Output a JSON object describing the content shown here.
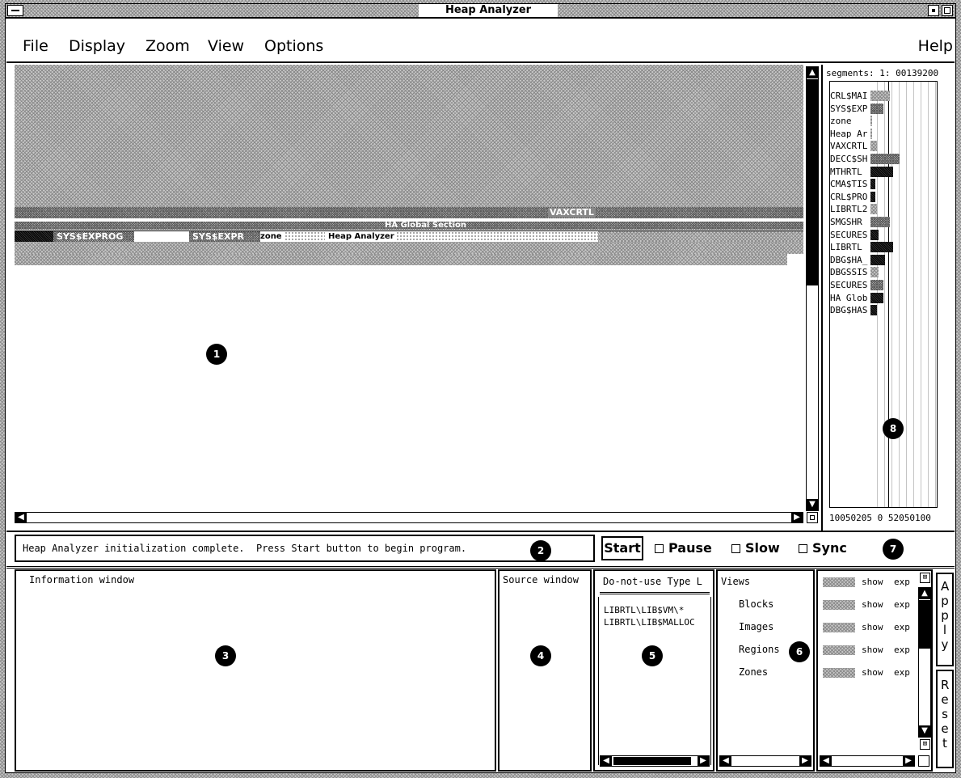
{
  "window": {
    "title": "Heap Analyzer"
  },
  "menu": {
    "file": "File",
    "display": "Display",
    "zoom": "Zoom",
    "view": "View",
    "options": "Options",
    "help": "Help"
  },
  "memory_map": {
    "band_labels": {
      "vaxcrtl": "VAXCRTL",
      "ha_global": "HA Global Section",
      "sys_exprog": "SYS$EXPROG",
      "sys_expr": "SYS$EXPR",
      "zone": "zone",
      "heap_analyzer": "Heap Analyzer"
    }
  },
  "histogram": {
    "header": "segments: 1: 00139200",
    "axis_labels": "10050205 0 52050100",
    "segments": [
      {
        "name": "CRL$MAI",
        "value": 12,
        "shade": "light"
      },
      {
        "name": "SYS$EXP",
        "value": 8,
        "shade": "medium"
      },
      {
        "name": "zone",
        "value": 1,
        "shade": "light"
      },
      {
        "name": "Heap Ar",
        "value": 1,
        "shade": "light"
      },
      {
        "name": "VAXCRTL",
        "value": 4,
        "shade": "light"
      },
      {
        "name": "DECC$SH",
        "value": 18,
        "shade": "medium"
      },
      {
        "name": "MTHRTL",
        "value": 14,
        "shade": "dark"
      },
      {
        "name": "CMA$TIS",
        "value": 3,
        "shade": "dark"
      },
      {
        "name": "CRL$PRO",
        "value": 3,
        "shade": "dark"
      },
      {
        "name": "LIBRTL2",
        "value": 4,
        "shade": "light"
      },
      {
        "name": "SMGSHR",
        "value": 12,
        "shade": "medium"
      },
      {
        "name": "SECURES",
        "value": 5,
        "shade": "dark"
      },
      {
        "name": "LIBRTL",
        "value": 14,
        "shade": "dark"
      },
      {
        "name": "DBG$HA_",
        "value": 9,
        "shade": "dark"
      },
      {
        "name": "DBGSSIS",
        "value": 5,
        "shade": "light"
      },
      {
        "name": "SECURES",
        "value": 8,
        "shade": "medium"
      },
      {
        "name": "HA Glob",
        "value": 8,
        "shade": "dark"
      },
      {
        "name": "DBG$HAS",
        "value": 4,
        "shade": "dark"
      }
    ]
  },
  "message": {
    "text": "Heap Analyzer initialization complete.  Press Start button to begin program."
  },
  "controls": {
    "start": "Start",
    "pause": "Pause",
    "slow": "Slow",
    "sync": "Sync"
  },
  "info": {
    "title": "Information window"
  },
  "source": {
    "title": "Source window"
  },
  "dnu": {
    "title": "Do-not-use Type L",
    "items": [
      "LIBRTL\\LIB$VM\\*",
      "LIBRTL\\LIB$MALLOC"
    ]
  },
  "views": {
    "title": "Views",
    "items": [
      "Blocks",
      "Images",
      "Regions",
      "Zones"
    ]
  },
  "types": {
    "rows": [
      {
        "show": "show",
        "exp": "exp"
      },
      {
        "show": "show",
        "exp": "exp"
      },
      {
        "show": "show",
        "exp": "exp"
      },
      {
        "show": "show",
        "exp": "exp"
      },
      {
        "show": "show",
        "exp": "exp"
      }
    ]
  },
  "buttons": {
    "apply": "Apply",
    "reset": "Reset"
  },
  "callouts": [
    "1",
    "2",
    "3",
    "4",
    "5",
    "6",
    "7",
    "8"
  ]
}
